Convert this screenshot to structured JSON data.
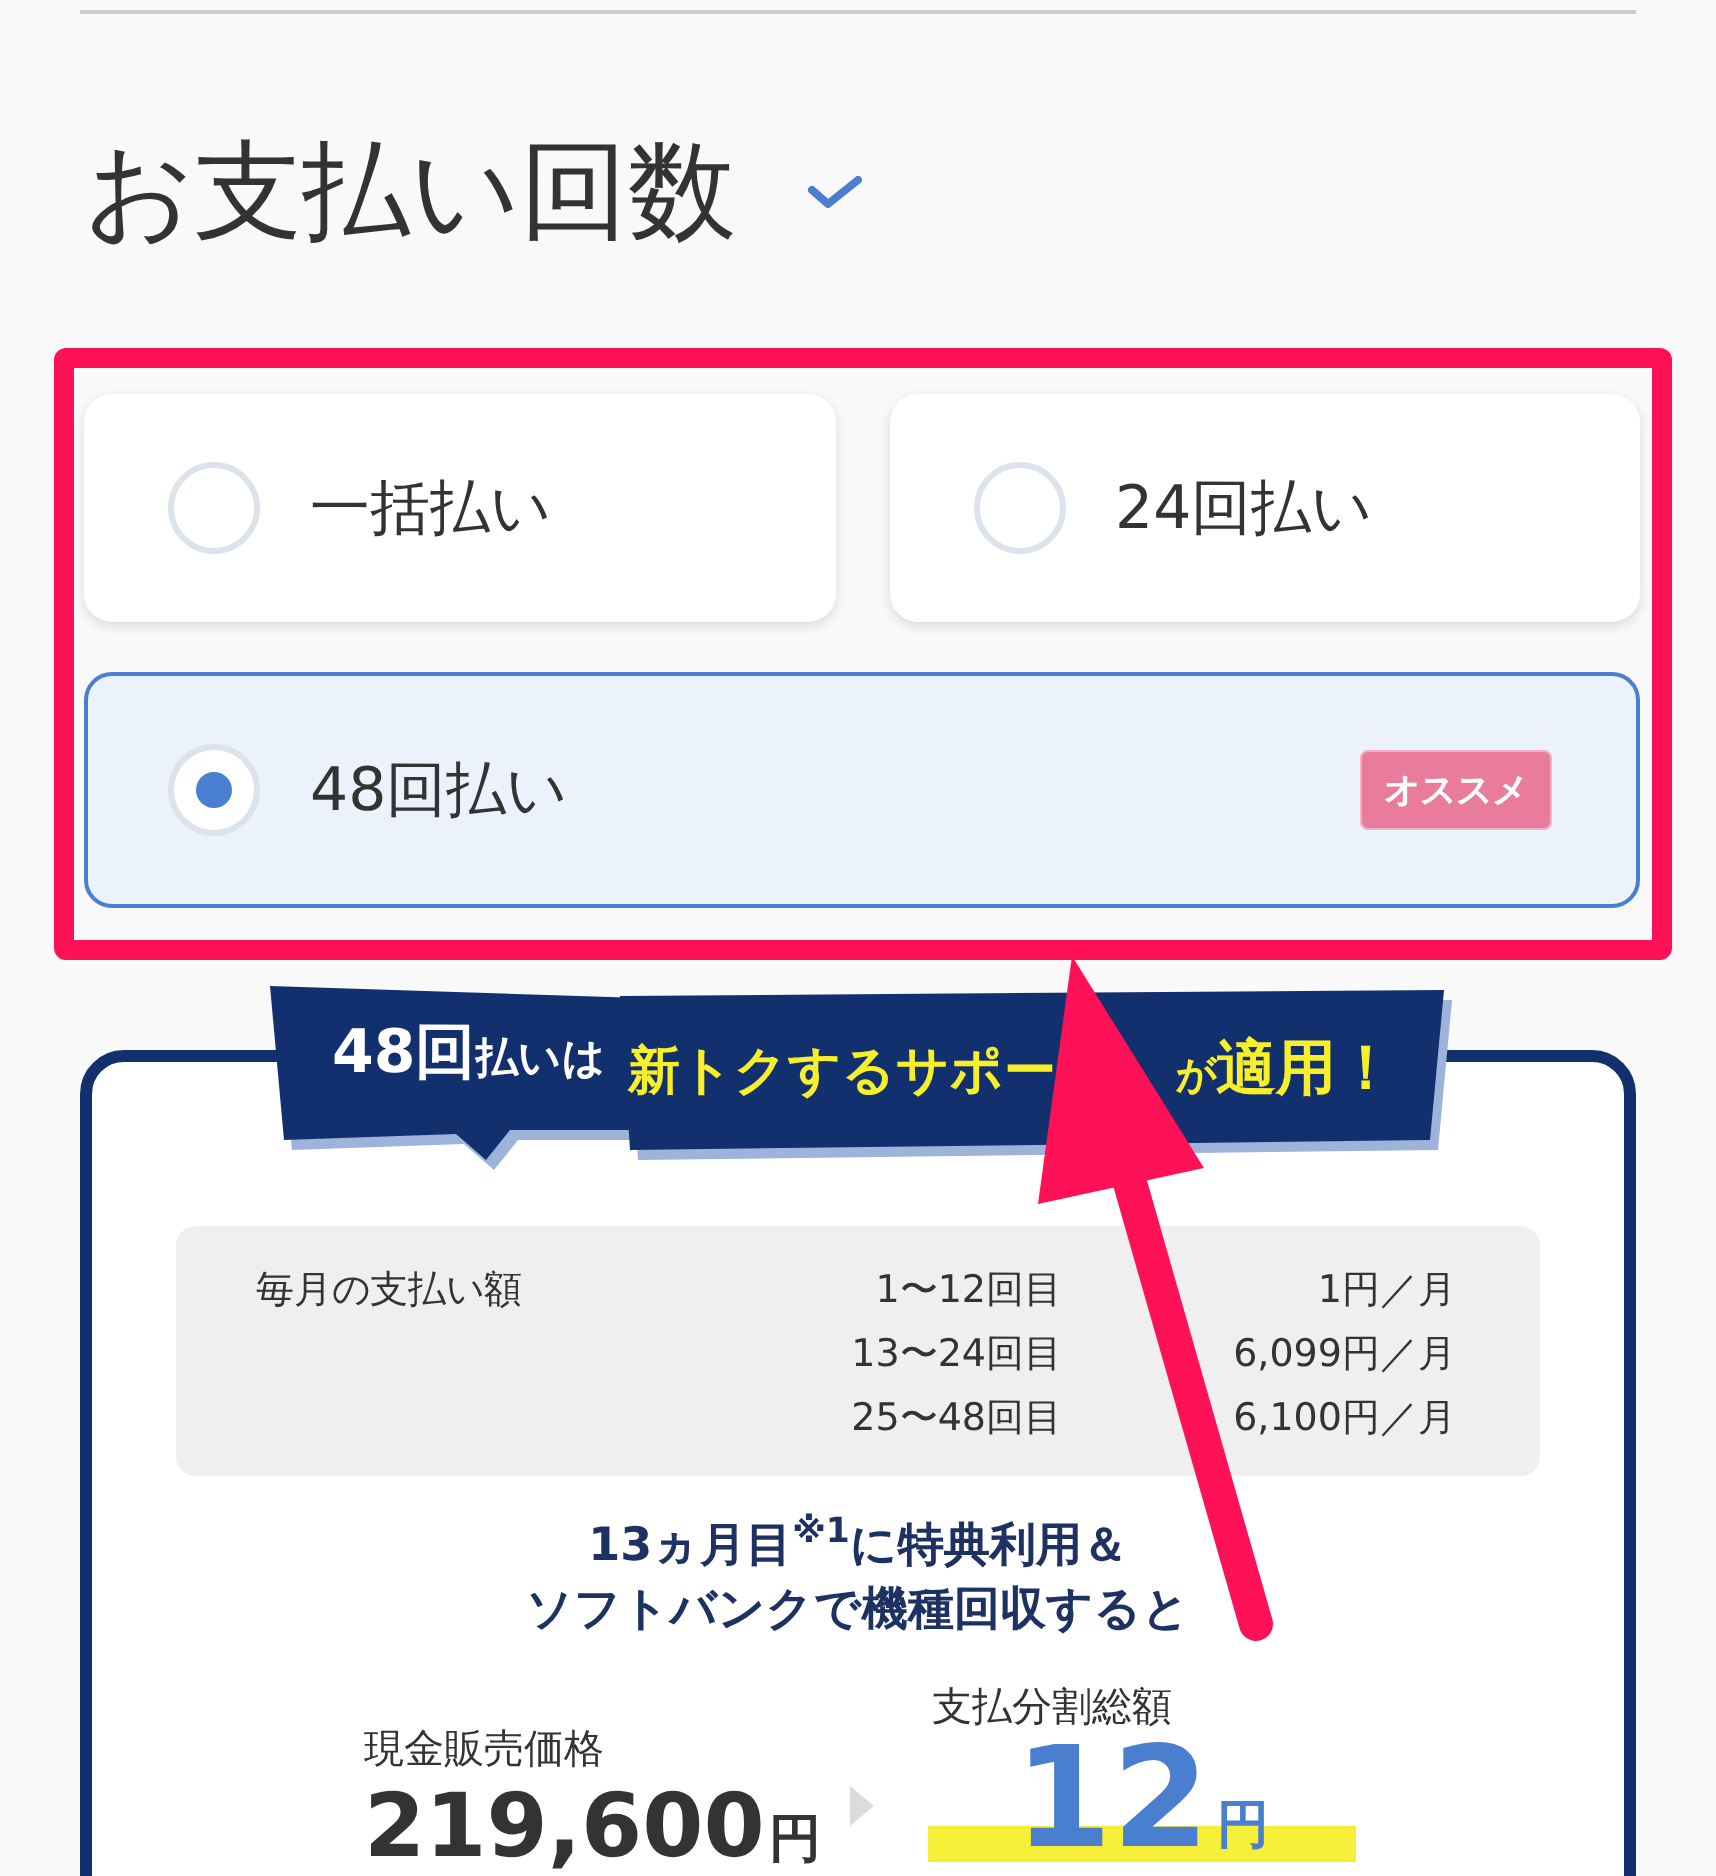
{
  "section": {
    "title": "お支払い回数",
    "complete": true
  },
  "payment_options": [
    {
      "label": "一括払い",
      "selected": false
    },
    {
      "label": "24回払い",
      "selected": false
    },
    {
      "label": "48回払い",
      "selected": true,
      "badge": "オススメ"
    }
  ],
  "banner": {
    "parts": [
      {
        "text": "48回",
        "kind": "lead_large"
      },
      {
        "text": "払いは",
        "kind": "lead_small"
      },
      {
        "text": "新トクするサポー",
        "kind": "highlight_cut"
      },
      {
        "text": "が",
        "kind": "particle"
      },
      {
        "text": "適用！",
        "kind": "highlight"
      }
    ]
  },
  "monthly_payments": {
    "label": "毎月の支払い額",
    "rows": [
      {
        "range": "1〜12回目",
        "amount": "1円／月"
      },
      {
        "range": "13〜24回目",
        "amount": "6,099円／月"
      },
      {
        "range": "25〜48回目",
        "amount": "6,100円／月"
      }
    ]
  },
  "condition": [
    "13ヵ月目$^{※1}$に特典利用＆",
    "ソフトバンクで機種回収すると"
  ],
  "prices": {
    "cash": {
      "label": "現金販売価格",
      "value": "219,600",
      "unit": "円"
    },
    "installment_total": {
      "label": "支払分割総額",
      "value": "12",
      "unit": "円"
    }
  }
}
